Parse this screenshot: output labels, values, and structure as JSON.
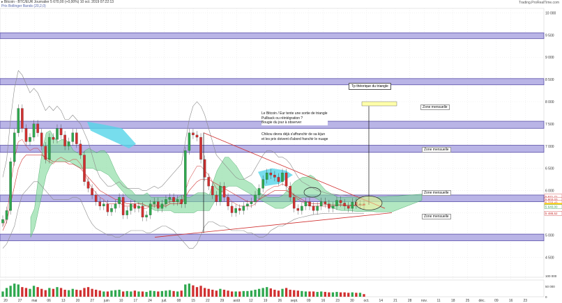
{
  "header": {
    "line1": "▸ Bitcoin - BTC/EUR   Journalier   5 670,00 (+0,00%)   10 oct. 2019 07:22:13",
    "line2": "Prix Bollinger Bands (20,2,0)",
    "brand": "Trading.ProRealTime.com"
  },
  "annotations": {
    "tp_label": "Tp théorique du triangle",
    "comment_lines": [
      "Le Bitcoin / Eur tente une sortie de triangle",
      "Pullback ou réintégration ?",
      "Bougie du jour à observer"
    ],
    "chikou_lines": [
      "Chikou devra déjà s'affranchir de sa kijun",
      "et les prix doivent d'abord franchir le nuage"
    ]
  },
  "zones": [
    {
      "label": "",
      "low": 9420,
      "high": 9550
    },
    {
      "label": "",
      "low": 8380,
      "high": 8520
    },
    {
      "label": "Zone mensuelle",
      "low": 7400,
      "high": 7560
    },
    {
      "label": "Zone mensuelle",
      "low": 6860,
      "high": 7020
    },
    {
      "label": "Zone mensuelle",
      "low": 5750,
      "high": 5900
    },
    {
      "label": "Zone mensuelle",
      "low": 4870,
      "high": 5020
    }
  ],
  "chart_data": {
    "type": "line",
    "title": "Bitcoin - BTC/EUR Journalier",
    "ylim": [
      4050,
      10100
    ],
    "y_ticks": [
      {
        "value": 10000,
        "label": "10 000"
      },
      {
        "value": 9500,
        "label": "9 500"
      },
      {
        "value": 9000,
        "label": "9 000"
      },
      {
        "value": 8500,
        "label": "8 500"
      },
      {
        "value": 8000,
        "label": "8 000"
      },
      {
        "value": 7500,
        "label": "7 500"
      },
      {
        "value": 7000,
        "label": "7 000"
      },
      {
        "value": 6500,
        "label": "6 500"
      },
      {
        "value": 6000,
        "label": "6 000"
      },
      {
        "value": 5500,
        "label": "5 500"
      },
      {
        "value": 5000,
        "label": "5 000"
      },
      {
        "value": 4500,
        "label": "4 500"
      }
    ],
    "price_tags": [
      {
        "value": 5871.71,
        "label": "5 871,71",
        "color": "#cc3333"
      },
      {
        "value": 5803.03,
        "label": "5 803,03",
        "color": "#cc3333"
      },
      {
        "value": 5733.43,
        "label": "5 733,43",
        "color": "#cc3333"
      },
      {
        "value": 5670.0,
        "label": "5 670,00",
        "color": "#ffcc00"
      },
      {
        "value": 5640.0,
        "label": "5 640,00",
        "color": "#3aa05a"
      },
      {
        "value": 5488.52,
        "label": "5 488,52",
        "color": "#cc3333"
      }
    ],
    "x_labels": [
      "20",
      "27",
      "mai",
      "06",
      "13",
      "20",
      "27",
      "juin",
      "10",
      "17",
      "24",
      "juil.",
      "08",
      "15",
      "22",
      "29",
      "août",
      "12",
      "19",
      "26",
      "sept.",
      "09",
      "16",
      "23",
      "30",
      "oct.",
      "14",
      "21",
      "28",
      "nov.",
      "11",
      "18",
      "25",
      "déc.",
      "09",
      "16",
      "23"
    ],
    "series": [
      {
        "name": "Bitcoin - BTC/EUR",
        "values": [
          5350,
          5550,
          6650,
          7300,
          7850,
          7400,
          7100,
          7200,
          7500,
          7300,
          7000,
          6700,
          7200,
          7150,
          7400,
          7250,
          7000,
          7100,
          7300,
          7050,
          6800,
          6200,
          6050,
          5900,
          5750,
          5650,
          5700,
          5520,
          5600,
          5700,
          5850,
          5450,
          5550,
          5700,
          5600,
          5650,
          5400,
          5450,
          5700,
          5750,
          5600,
          5700,
          5800,
          5850,
          5750,
          5800,
          5700,
          6900,
          7300,
          7250,
          7200,
          6700,
          6300,
          6100,
          5900,
          5750,
          6100,
          5850,
          5650,
          5500,
          5600,
          5550,
          5650,
          5700,
          5750,
          5900,
          6050,
          6250,
          6400,
          6350,
          6300,
          6200,
          6400,
          6100,
          5850,
          5600,
          5550,
          5650,
          5750,
          5650,
          5550,
          5650,
          5750,
          5700,
          5600,
          5650,
          5780,
          5720,
          5650,
          5600,
          5740,
          5680,
          5700,
          5670
        ]
      },
      {
        "name": "",
        "values": [
          5200,
          5400,
          6100,
          6700,
          7100,
          7150,
          7000,
          6900,
          6950,
          6950,
          6850,
          6700,
          6650,
          6600,
          6700,
          6750,
          6700,
          6650,
          6700,
          6700,
          6600,
          6400,
          6200,
          6050,
          5950,
          5850,
          5800,
          5700,
          5700,
          5700,
          5750,
          5650,
          5650,
          5650,
          5650,
          5650,
          5600,
          5600,
          5650,
          5700,
          5650,
          5650,
          5700,
          5750,
          5750,
          5750,
          5700,
          6000,
          6250,
          6400,
          6550,
          6550,
          6450,
          6350,
          6200,
          6050,
          6000,
          5950,
          5850,
          5750,
          5700,
          5650,
          5650,
          5650,
          5650,
          5700,
          5800,
          5900,
          6000,
          6050,
          6100,
          6100,
          6150,
          6100,
          6000,
          5900,
          5800,
          5750,
          5700,
          5650,
          5650,
          5650,
          5650,
          5650,
          5650,
          5650,
          5670,
          5670,
          5660,
          5650,
          5660,
          5660,
          5670,
          5670
        ]
      },
      {
        "name": "",
        "values": [
          5100,
          5300,
          5700,
          6100,
          6500,
          6700,
          6800,
          6800,
          6800,
          6800,
          6800,
          6750,
          6700,
          6650,
          6650,
          6650,
          6650,
          6600,
          6600,
          6550,
          6500,
          6400,
          6300,
          6200,
          6100,
          6000,
          5950,
          5900,
          5850,
          5800,
          5800,
          5750,
          5700,
          5700,
          5700,
          5700,
          5700,
          5650,
          5650,
          5650,
          5650,
          5650,
          5650,
          5700,
          5700,
          5700,
          5700,
          5850,
          6000,
          6100,
          6200,
          6250,
          6250,
          6250,
          6200,
          6150,
          6100,
          6050,
          6000,
          5950,
          5900,
          5850,
          5800,
          5750,
          5750,
          5750,
          5800,
          5850,
          5900,
          5950,
          6000,
          6000,
          6000,
          6000,
          5950,
          5900,
          5850,
          5800,
          5750,
          5720,
          5700,
          5700,
          5700,
          5690,
          5680,
          5680,
          5680,
          5680,
          5680,
          5670,
          5670,
          5670,
          5670,
          5670
        ]
      },
      {
        "name": "",
        "values": [
          6300,
          6700,
          7600,
          8300,
          8700,
          8600,
          8400,
          8200,
          8300,
          8200,
          8000,
          7800,
          7900,
          7800,
          7900,
          7800,
          7600,
          7600,
          7700,
          7600,
          7500,
          7300,
          7100,
          6800,
          6500,
          6300,
          6200,
          6100,
          6100,
          6150,
          6200,
          6100,
          6050,
          6050,
          6050,
          6050,
          6000,
          6000,
          6050,
          6100,
          6050,
          6100,
          6200,
          6300,
          6400,
          6500,
          6600,
          7100,
          7600,
          7900,
          8000,
          7900,
          7700,
          7400,
          7100,
          6800,
          6700,
          6600,
          6500,
          6400,
          6300,
          6250,
          6250,
          6300,
          6350,
          6500,
          6650,
          6800,
          6900,
          6900,
          6850,
          6750,
          6750,
          6700,
          6600,
          6450,
          6300,
          6200,
          6150,
          6100,
          6050,
          6000,
          5980,
          5950,
          5930,
          5920,
          5910,
          5900,
          5890,
          5880,
          5875,
          5872,
          5871,
          5871
        ]
      },
      {
        "name": "",
        "values": [
          4700,
          4800,
          5000,
          5200,
          5600,
          5900,
          6000,
          6100,
          6200,
          6200,
          6100,
          6000,
          5900,
          5800,
          5800,
          5800,
          5800,
          5800,
          5850,
          5850,
          5800,
          5600,
          5400,
          5250,
          5150,
          5100,
          5050,
          5000,
          5000,
          4950,
          4950,
          5000,
          5050,
          5100,
          5100,
          5100,
          5100,
          5050,
          5050,
          5100,
          5150,
          5200,
          5200,
          5150,
          5100,
          5000,
          4900,
          4800,
          4700,
          4700,
          4800,
          5000,
          5200,
          5300,
          5300,
          5250,
          5200,
          5200,
          5150,
          5100,
          5100,
          5100,
          5100,
          5050,
          5050,
          5000,
          4950,
          4950,
          5000,
          5100,
          5150,
          5200,
          5200,
          5250,
          5300,
          5350,
          5380,
          5400,
          5420,
          5440,
          5460,
          5470,
          5480,
          5485,
          5488,
          5488,
          5488,
          5489,
          5489,
          5489,
          5489,
          5489,
          5489,
          5489
        ]
      }
    ],
    "volume": [
      12,
      20,
      25,
      30,
      28,
      22,
      20,
      18,
      25,
      22,
      18,
      15,
      20,
      18,
      22,
      20,
      16,
      15,
      18,
      16,
      15,
      20,
      22,
      18,
      16,
      14,
      12,
      12,
      14,
      15,
      16,
      12,
      13,
      12,
      14,
      12,
      12,
      11,
      14,
      13,
      12,
      13,
      14,
      15,
      13,
      12,
      14,
      28,
      30,
      26,
      22,
      25,
      20,
      18,
      16,
      14,
      18,
      16,
      14,
      12,
      12,
      12,
      13,
      13,
      14,
      16,
      18,
      20,
      22,
      19,
      16,
      14,
      18,
      20,
      16,
      15,
      14,
      13,
      12,
      12,
      12,
      11,
      12,
      11,
      10,
      10,
      11,
      10,
      10,
      9,
      10,
      9,
      9,
      6
    ],
    "volume_ticks": [
      {
        "value": 100,
        "label": "100 000"
      },
      {
        "value": 50,
        "label": "50 000"
      },
      {
        "value": 0,
        "label": "0"
      }
    ]
  }
}
